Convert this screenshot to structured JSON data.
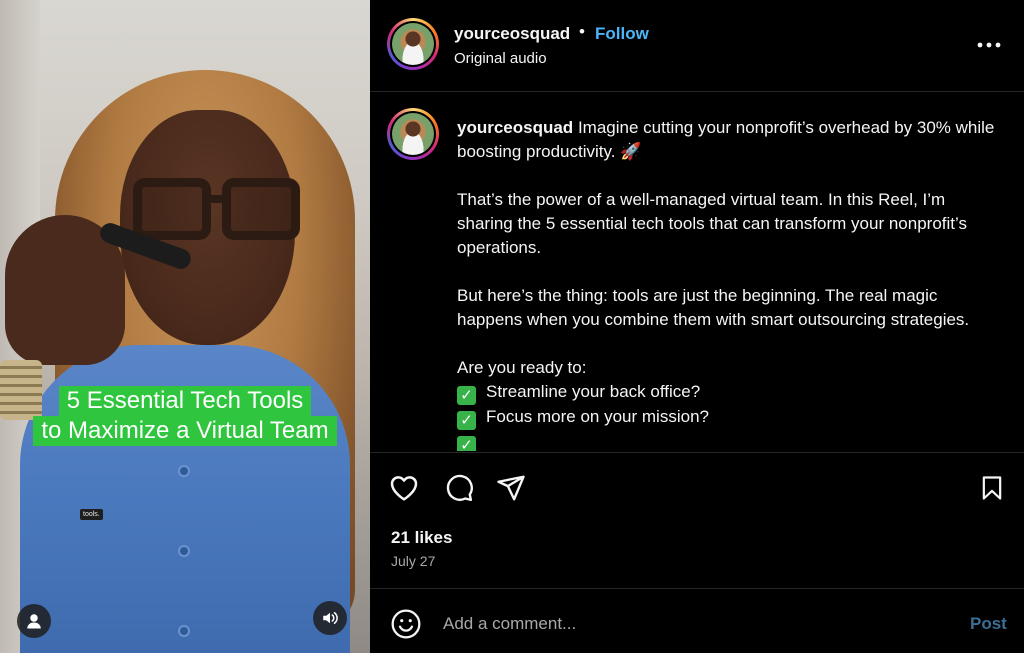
{
  "video": {
    "overlay_line1": "5 Essential Tech Tools",
    "overlay_line2": "to Maximize a Virtual Team",
    "small_label": "tools.",
    "user_icon": "user-icon",
    "sound_icon": "speaker-icon"
  },
  "header": {
    "username": "yourceosquad",
    "dot": "•",
    "follow_label": "Follow",
    "subtitle": "Original audio",
    "more_icon": "more-horizontal-icon",
    "follow_color": "#4cb5f9"
  },
  "caption": {
    "username": "yourceosquad",
    "line1": "Imagine cutting your nonprofit’s overhead by 30% while boosting productivity. 🚀",
    "para2": "That’s the power of a well-managed virtual team. In this Reel, I’m sharing the 5 essential tech tools that can transform your nonprofit’s operations.",
    "para3": "But here’s the thing: tools are just the beginning. The real magic happens when you combine them with smart outsourcing strategies.",
    "ready": "Are you ready to:",
    "checks": [
      "Streamline your back office?",
      "Focus more on your mission?"
    ],
    "check_color": "#38b34a"
  },
  "actions": {
    "like_icon": "heart-icon",
    "comment_icon": "comment-icon",
    "share_icon": "send-icon",
    "save_icon": "bookmark-icon",
    "likes": "21 likes",
    "date": "July 27"
  },
  "comment_box": {
    "emoji_icon": "smiley-icon",
    "placeholder": "Add a comment...",
    "post_label": "Post",
    "post_color": "#3b6f94"
  },
  "colors": {
    "background": "#000000",
    "overlay_green": "#2fc53e"
  }
}
